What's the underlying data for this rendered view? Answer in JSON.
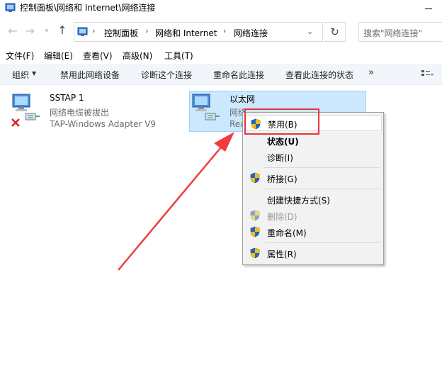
{
  "window": {
    "title": "控制面板\\网络和 Internet\\网络连接"
  },
  "nav": {
    "back_glyph": "←",
    "forward_glyph": "→",
    "recent_glyph": "▾",
    "up_glyph": "↑",
    "breadcrumbs": [
      "控制面板",
      "网络和 Internet",
      "网络连接"
    ],
    "crumb_separator": "›",
    "address_dropdown_glyph": "⌄",
    "refresh_glyph": "↻",
    "search_placeholder": "搜索\"网络连接\""
  },
  "menubar": {
    "items": [
      "文件(F)",
      "编辑(E)",
      "查看(V)",
      "高级(N)",
      "工具(T)"
    ]
  },
  "commandbar": {
    "items": [
      "组织",
      "禁用此网络设备",
      "诊断这个连接",
      "重命名此连接",
      "查看此连接的状态"
    ],
    "caret_glyph": "▼",
    "more_glyph": "»"
  },
  "connections": [
    {
      "name": "SSTAP 1",
      "status": "网络电缆被拔出",
      "adapter": "TAP-Windows Adapter V9",
      "disconnected": true
    },
    {
      "name": "以太网",
      "status": "网络",
      "adapter": "Rea",
      "disconnected": false
    }
  ],
  "context_menu": {
    "items": [
      {
        "label": "禁用(B)",
        "shield": true,
        "bold": false,
        "disabled": false
      },
      {
        "label": "状态(U)",
        "shield": false,
        "bold": true,
        "disabled": false
      },
      {
        "label": "诊断(I)",
        "shield": false,
        "bold": false,
        "disabled": false
      },
      {
        "label": "桥接(G)",
        "shield": true,
        "bold": false,
        "disabled": false
      },
      {
        "label": "创建快捷方式(S)",
        "shield": false,
        "bold": false,
        "disabled": false
      },
      {
        "label": "删除(D)",
        "shield": true,
        "bold": false,
        "disabled": true
      },
      {
        "label": "重命名(M)",
        "shield": true,
        "bold": false,
        "disabled": false
      },
      {
        "label": "属性(R)",
        "shield": true,
        "bold": false,
        "disabled": false
      }
    ]
  },
  "colors": {
    "selection_bg": "#cce8ff",
    "highlight_red": "#e8373b",
    "shield_blue": "#2a63c5",
    "shield_yellow": "#f2c200"
  }
}
